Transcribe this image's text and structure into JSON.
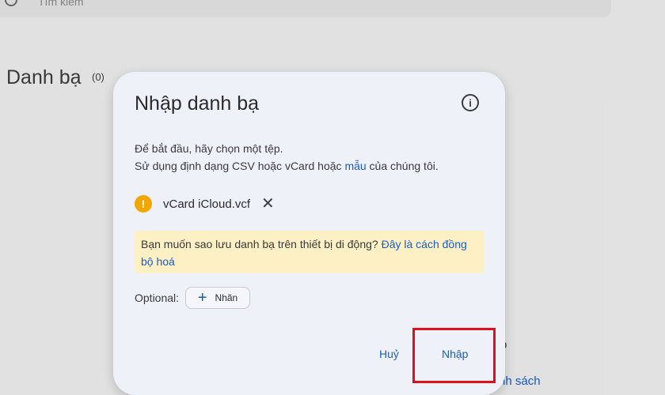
{
  "background": {
    "search_placeholder": "Tìm kiếm",
    "contacts_title": "Danh bạ",
    "contacts_count": "(0)",
    "peek_text_1": "o",
    "peek_text_2": "nh sách"
  },
  "dialog": {
    "title": "Nhập danh bạ",
    "info_icon": "info-icon",
    "line1": "Để bắt đầu, hãy chọn một tệp.",
    "line2_prefix": "Sử dụng định dạng CSV hoặc vCard hoặc ",
    "line2_link": "mẫu",
    "line2_suffix": " của chúng tôi.",
    "file": {
      "icon": "warning-icon",
      "name": "vCard iCloud.vcf",
      "remove_icon": "close-icon"
    },
    "notice": {
      "text": "Bạn muốn sao lưu danh bạ trên thiết bị di động? ",
      "link": "Đây là cách đồng bộ hoá"
    },
    "optional_label": "Optional:",
    "label_chip": "Nhãn",
    "cancel_label": "Huỷ",
    "import_label": "Nhập"
  },
  "colors": {
    "accent": "#1a5cc8",
    "notice_bg": "#fdf0c4",
    "warning": "#f2a600",
    "highlight": "#e0101b"
  }
}
